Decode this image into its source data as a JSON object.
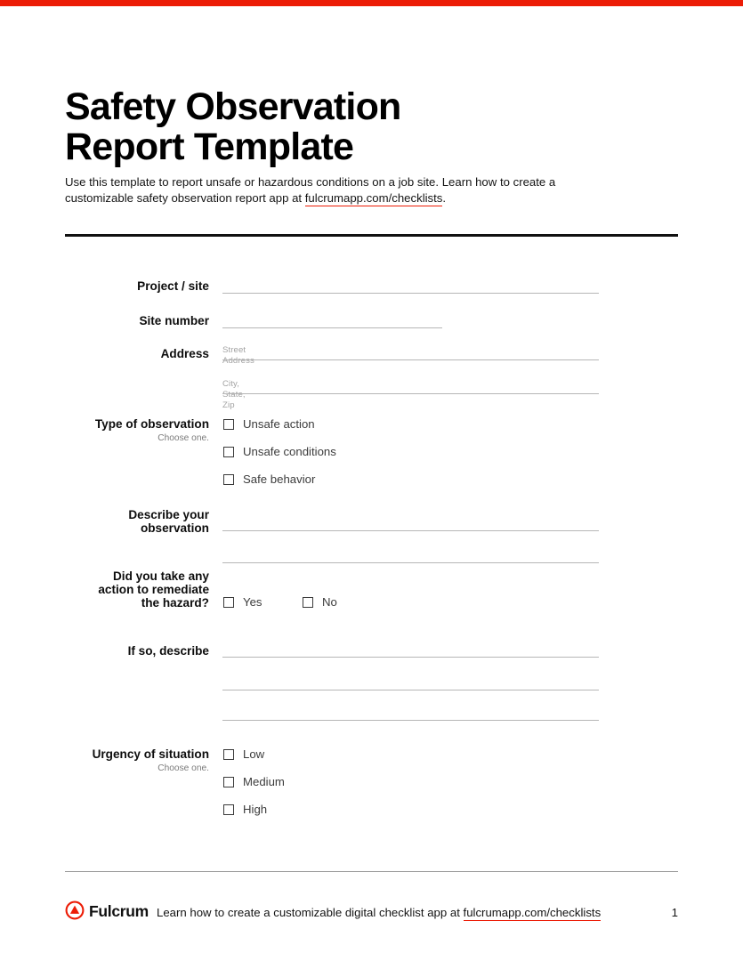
{
  "document": {
    "title_line1": "Safety Observation",
    "title_line2": "Report Template",
    "intro_before": "Use this template to report unsafe or hazardous conditions on a job site. Learn how to create a customizable safety observation report app at ",
    "intro_link": "fulcrumapp.com/checklists",
    "intro_after": "."
  },
  "theme": {
    "accent_red": "#ec1c06",
    "rule_gray": "#b6b6b6",
    "text_black": "#111111",
    "muted_gray": "#7b7b7b"
  },
  "fields": {
    "project_site": {
      "label": "Project / site"
    },
    "site_number": {
      "label": "Site number"
    },
    "address": {
      "label": "Address",
      "placeholder_street": "Street Address",
      "placeholder_city": "City, State, Zip"
    },
    "type_of_observation": {
      "label": "Type of observation",
      "sublabel": "Choose one.",
      "options": [
        {
          "label": "Unsafe action"
        },
        {
          "label": "Unsafe conditions"
        },
        {
          "label": "Safe behavior"
        }
      ]
    },
    "describe_observation": {
      "label_line1": "Describe your",
      "label_line2": "observation"
    },
    "remediate_hazard": {
      "label_line1": "Did you take any",
      "label_line2": "action to remediate",
      "label_line3": "the hazard?",
      "options": [
        {
          "label": "Yes"
        },
        {
          "label": "No"
        }
      ]
    },
    "if_so_describe": {
      "label": "If so, describe"
    },
    "urgency": {
      "label": "Urgency of situation",
      "sublabel": "Choose one.",
      "options": [
        {
          "label": "Low"
        },
        {
          "label": "Medium"
        },
        {
          "label": "High"
        }
      ]
    }
  },
  "footer": {
    "brand": "Fulcrum",
    "text_before": "Learn how to create a customizable digital checklist app at ",
    "link": "fulcrumapp.com/checklists",
    "page_number": "1"
  }
}
